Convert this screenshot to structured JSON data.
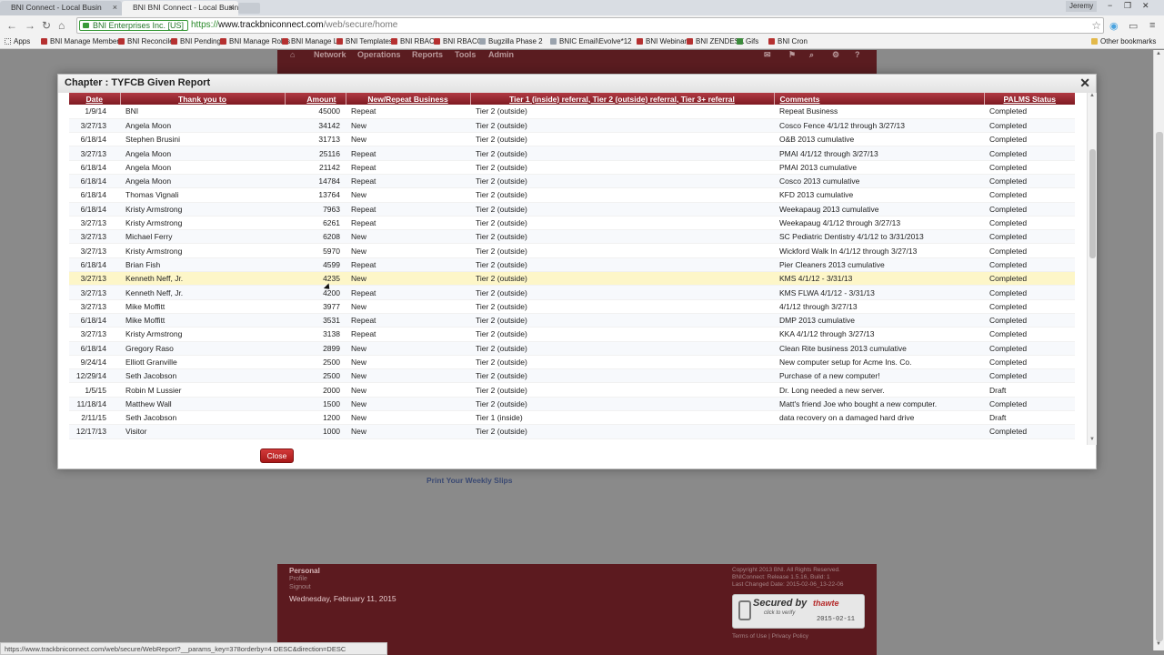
{
  "browser": {
    "tabs": [
      {
        "label": "BNI Connect - Local Busin",
        "active": false
      },
      {
        "label": "BNI Connect - Local Busin",
        "active": true
      }
    ],
    "tab_badge": "BNI",
    "user": "Jeremy",
    "window_controls": {
      "minimize": "−",
      "restore": "❐",
      "close": "✕"
    },
    "nav_icons": {
      "back": "←",
      "forward": "→",
      "reload": "↻",
      "home": "⌂"
    },
    "ev_cert": "BNI Enterprises Inc. [US]",
    "url": {
      "scheme": "https://",
      "host": "www.trackbniconnect.com",
      "path": "/web/secure/home"
    },
    "bookmarks": [
      "Apps",
      "BNI Manage Members",
      "BNI Reconcile",
      "BNI Pending",
      "BNI Manage Roles",
      "BNI Manage LT",
      "BNI Templates",
      "BNI RBACR",
      "BNI RBACC",
      "Bugzilla Phase 2",
      "BNIC Email\\Evolve*12",
      "BNI Webinars",
      "BNI ZENDESK",
      "Gifs",
      "BNI Cron"
    ],
    "other_bookmarks": "Other bookmarks",
    "status_url": "https://www.trackbniconnect.com/web/secure/WebReport?__params_key=378orderby=4 DESC&direction=DESC"
  },
  "page": {
    "nav": [
      "Network",
      "Operations",
      "Reports",
      "Tools",
      "Admin"
    ],
    "print_link": "Print Your Weekly Slips",
    "footer": {
      "section": "Personal",
      "links": [
        "Profile",
        "Signout"
      ],
      "date": "Wednesday, February 11, 2015",
      "copyright": [
        "Copyright 2013 BNI. All Rights Reserved.",
        "BNIConnect: Release 1.5.16, Build: 1",
        "Last Changed Date: 2015-02-06_13-22-06"
      ],
      "seal": {
        "title": "Secured by",
        "sub": "click to verify",
        "brand": "thawte",
        "date": "2015-02-11"
      },
      "terms": "Terms of Use  |  Privacy Policy"
    }
  },
  "modal": {
    "title": "Chapter : TYFCB Given Report",
    "close_icon": "✕",
    "close_button": "Close",
    "columns": [
      "Date",
      "Thank you to",
      "Amount",
      "New/Repeat Business",
      "Tier 1 (inside) referral, Tier 2 (outside) referral, Tier 3+ referral",
      "Comments",
      "PALMS Status"
    ],
    "rows": [
      [
        "1/9/14",
        "BNI",
        "45000",
        "Repeat",
        "Tier 2 (outside)",
        "Repeat Business",
        "Completed"
      ],
      [
        "3/27/13",
        "Angela Moon",
        "34142",
        "New",
        "Tier 2 (outside)",
        "Cosco Fence 4/1/12 through 3/27/13",
        "Completed"
      ],
      [
        "6/18/14",
        "Stephen Brusini",
        "31713",
        "New",
        "Tier 2 (outside)",
        "O&B 2013 cumulative",
        "Completed"
      ],
      [
        "3/27/13",
        "Angela Moon",
        "25116",
        "Repeat",
        "Tier 2 (outside)",
        "PMAI 4/1/12 through 3/27/13",
        "Completed"
      ],
      [
        "6/18/14",
        "Angela Moon",
        "21142",
        "Repeat",
        "Tier 2 (outside)",
        "PMAI 2013 cumulative",
        "Completed"
      ],
      [
        "6/18/14",
        "Angela Moon",
        "14784",
        "Repeat",
        "Tier 2 (outside)",
        "Cosco 2013 cumulative",
        "Completed"
      ],
      [
        "6/18/14",
        "Thomas Vignali",
        "13764",
        "New",
        "Tier 2 (outside)",
        "KFD 2013 cumulative",
        "Completed"
      ],
      [
        "6/18/14",
        "Kristy Armstrong",
        "7963",
        "Repeat",
        "Tier 2 (outside)",
        "Weekapaug 2013 cumulative",
        "Completed"
      ],
      [
        "3/27/13",
        "Kristy Armstrong",
        "6261",
        "Repeat",
        "Tier 2 (outside)",
        "Weekapaug 4/1/12 through 3/27/13",
        "Completed"
      ],
      [
        "3/27/13",
        "Michael Ferry",
        "6208",
        "New",
        "Tier 2 (outside)",
        "SC Pediatric Dentistry 4/1/12 to 3/31/2013",
        "Completed"
      ],
      [
        "3/27/13",
        "Kristy Armstrong",
        "5970",
        "New",
        "Tier 2 (outside)",
        "Wickford Walk In 4/1/12 through 3/27/13",
        "Completed"
      ],
      [
        "6/18/14",
        "Brian Fish",
        "4599",
        "Repeat",
        "Tier 2 (outside)",
        "Pier Cleaners 2013 cumulative",
        "Completed"
      ],
      [
        "3/27/13",
        "Kenneth Neff, Jr.",
        "4235",
        "New",
        "Tier 2 (outside)",
        "KMS 4/1/12 - 3/31/13",
        "Completed"
      ],
      [
        "3/27/13",
        "Kenneth Neff, Jr.",
        "4200",
        "Repeat",
        "Tier 2 (outside)",
        "KMS FLWA 4/1/12 - 3/31/13",
        "Completed"
      ],
      [
        "3/27/13",
        "Mike Moffitt",
        "3977",
        "New",
        "Tier 2 (outside)",
        "4/1/12 through 3/27/13",
        "Completed"
      ],
      [
        "6/18/14",
        "Mike Moffitt",
        "3531",
        "Repeat",
        "Tier 2 (outside)",
        "DMP 2013 cumulative",
        "Completed"
      ],
      [
        "3/27/13",
        "Kristy Armstrong",
        "3138",
        "Repeat",
        "Tier 2 (outside)",
        "KKA 4/1/12 through 3/27/13",
        "Completed"
      ],
      [
        "6/18/14",
        "Gregory Raso",
        "2899",
        "New",
        "Tier 2 (outside)",
        "Clean Rite business 2013 cumulative",
        "Completed"
      ],
      [
        "9/24/14",
        "Elliott Granville",
        "2500",
        "New",
        "Tier 2 (outside)",
        "New computer setup for Acme Ins. Co.",
        "Completed"
      ],
      [
        "12/29/14",
        "Seth Jacobson",
        "2500",
        "New",
        "Tier 2 (outside)",
        "Purchase of a new computer!",
        "Completed"
      ],
      [
        "1/5/15",
        "Robin M Lussier",
        "2000",
        "New",
        "Tier 2 (outside)",
        "Dr. Long needed a new server.",
        "Draft"
      ],
      [
        "11/18/14",
        "Matthew Wall",
        "1500",
        "New",
        "Tier 2 (outside)",
        "Matt's friend Joe who bought a new computer.",
        "Completed"
      ],
      [
        "2/11/15",
        "Seth Jacobson",
        "1200",
        "New",
        "Tier 1 (inside)",
        "data recovery on a damaged hard drive",
        "Draft"
      ],
      [
        "12/17/13",
        "Visitor",
        "1000",
        "New",
        "Tier 2 (outside)",
        "",
        "Completed"
      ]
    ],
    "highlighted_row": 12
  }
}
